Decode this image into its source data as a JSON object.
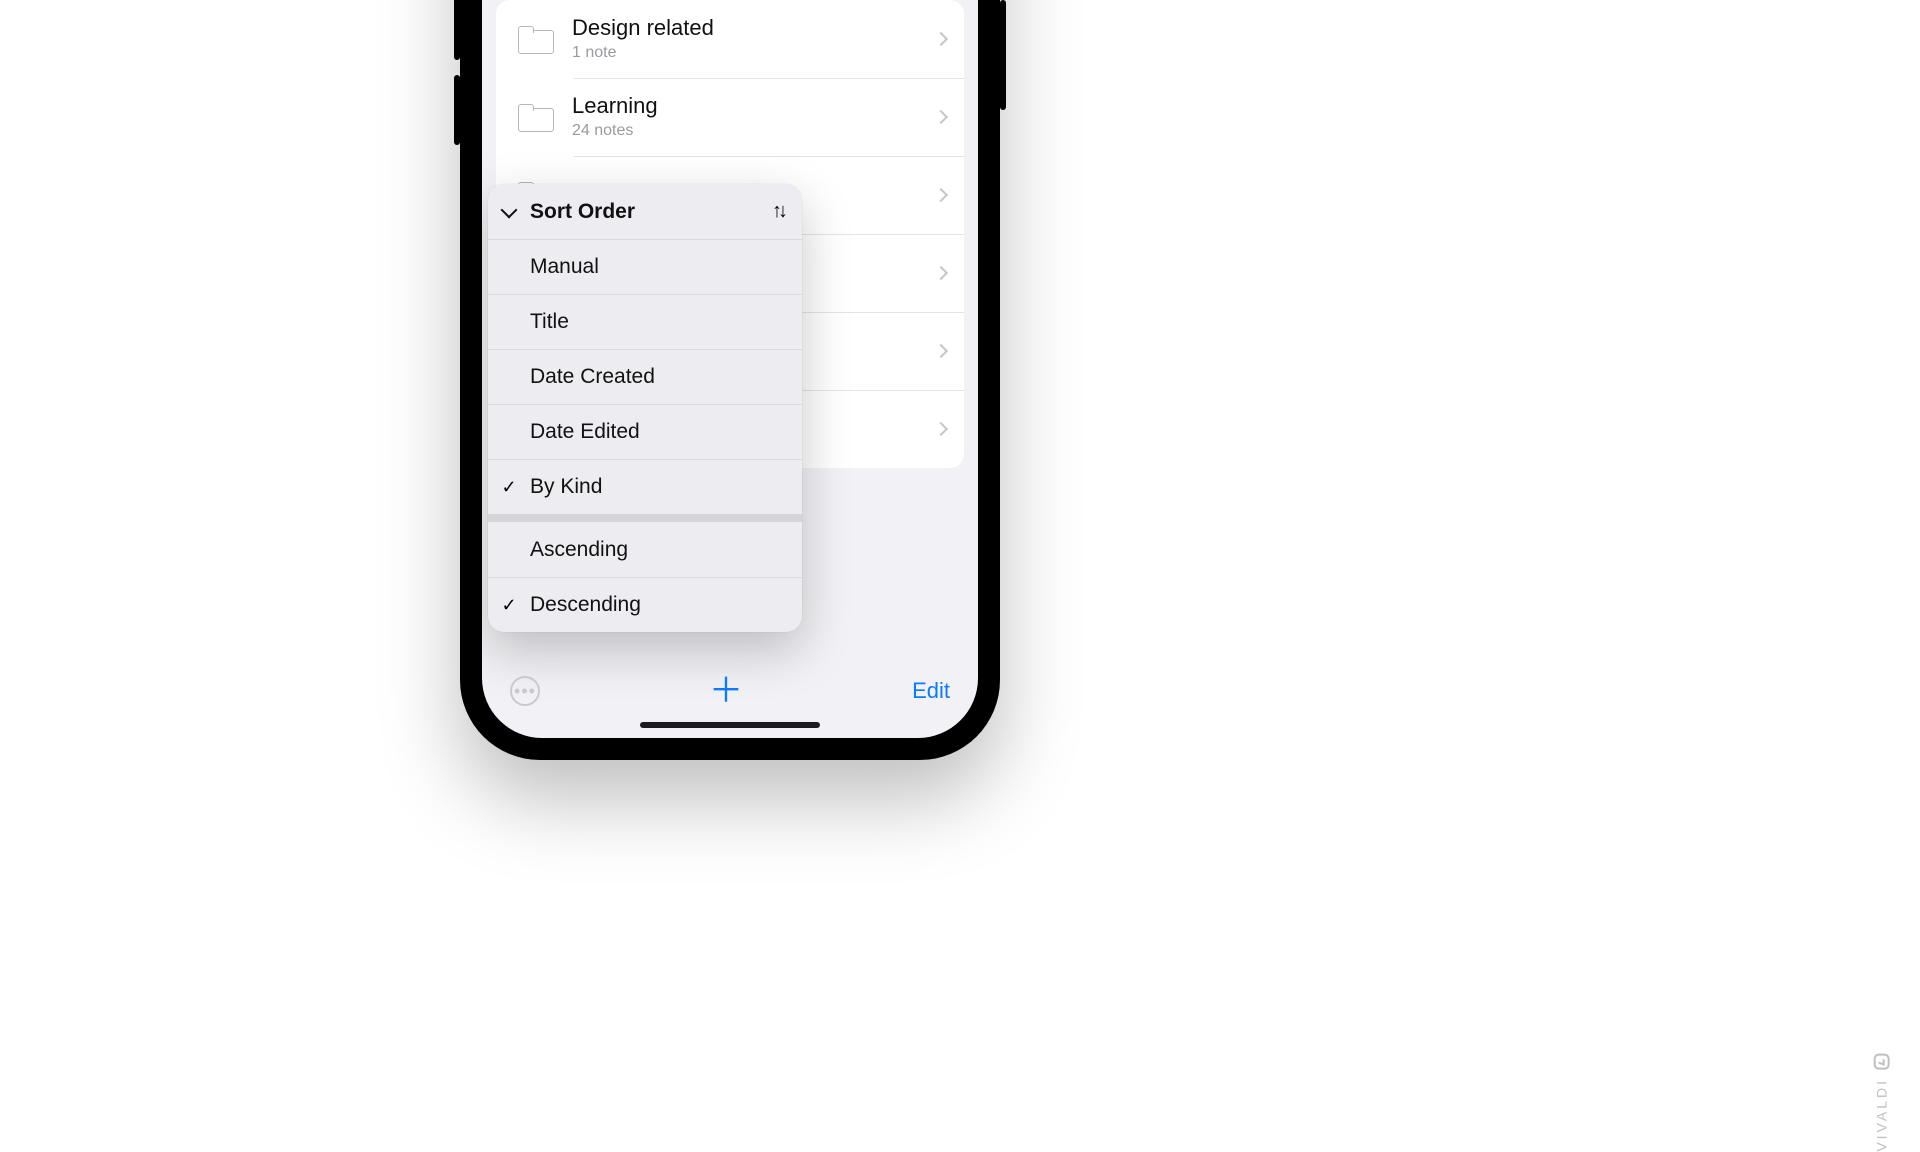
{
  "folders": [
    {
      "title": "Design related",
      "sub": "1 note"
    },
    {
      "title": "Learning",
      "sub": "24 notes"
    },
    {
      "title": "",
      "sub": ""
    },
    {
      "title": "",
      "sub": ""
    },
    {
      "title": "",
      "sub": ""
    },
    {
      "title": "",
      "sub": ""
    }
  ],
  "popover": {
    "header": "Sort Order",
    "options": [
      {
        "label": "Manual",
        "checked": false
      },
      {
        "label": "Title",
        "checked": false
      },
      {
        "label": "Date Created",
        "checked": false
      },
      {
        "label": "Date Edited",
        "checked": false
      },
      {
        "label": "By Kind",
        "checked": true
      }
    ],
    "direction": [
      {
        "label": "Ascending",
        "checked": false
      },
      {
        "label": "Descending",
        "checked": true
      }
    ]
  },
  "toolbar": {
    "edit": "Edit"
  },
  "watermark": "VIVALDI"
}
